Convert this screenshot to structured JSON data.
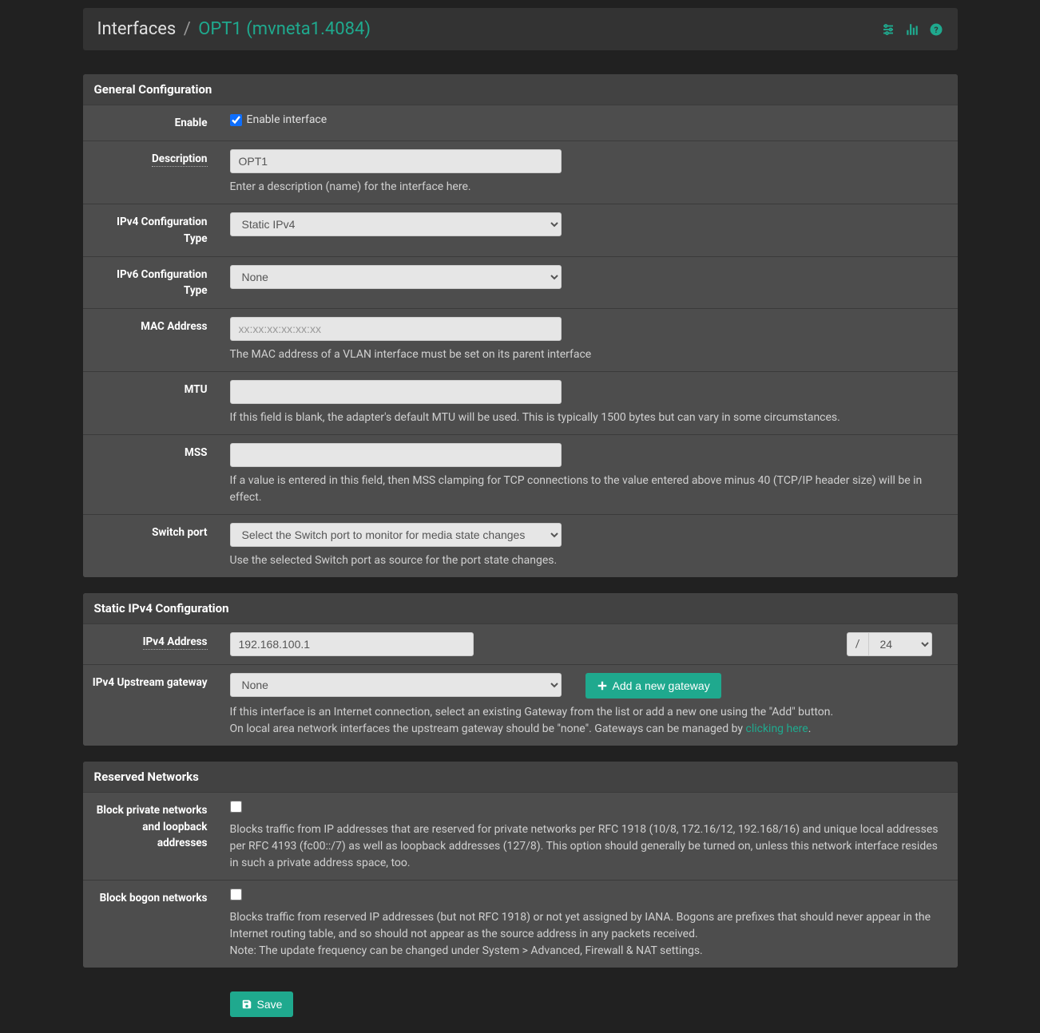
{
  "breadcrumb": {
    "root": "Interfaces",
    "sep": "/",
    "current": "OPT1 (mvneta1.4084)"
  },
  "sections": {
    "general": {
      "title": "General Configuration",
      "enable": {
        "label": "Enable",
        "text": "Enable interface",
        "checked": true
      },
      "description": {
        "label": "Description",
        "value": "OPT1",
        "help": "Enter a description (name) for the interface here."
      },
      "ipv4type": {
        "label": "IPv4 Configuration Type",
        "selected": "Static IPv4"
      },
      "ipv6type": {
        "label": "IPv6 Configuration Type",
        "selected": "None"
      },
      "mac": {
        "label": "MAC Address",
        "placeholder": "xx:xx:xx:xx:xx:xx",
        "help": "The MAC address of a VLAN interface must be set on its parent interface"
      },
      "mtu": {
        "label": "MTU",
        "help": "If this field is blank, the adapter's default MTU will be used. This is typically 1500 bytes but can vary in some circumstances."
      },
      "mss": {
        "label": "MSS",
        "help": "If a value is entered in this field, then MSS clamping for TCP connections to the value entered above minus 40 (TCP/IP header size) will be in effect."
      },
      "switchport": {
        "label": "Switch port",
        "selected": "Select the Switch port to monitor for media state changes",
        "help": "Use the selected Switch port as source for the port state changes."
      }
    },
    "staticipv4": {
      "title": "Static IPv4 Configuration",
      "address": {
        "label": "IPv4 Address",
        "value": "192.168.100.1",
        "slash": "/",
        "prefix": "24"
      },
      "gateway": {
        "label": "IPv4 Upstream gateway",
        "selected": "None",
        "button": "Add a new gateway",
        "help1": "If this interface is an Internet connection, select an existing Gateway from the list or add a new one using the \"Add\" button.",
        "help2a": "On local area network interfaces the upstream gateway should be \"none\". Gateways can be managed by ",
        "help2link": "clicking here",
        "help2b": "."
      }
    },
    "reserved": {
      "title": "Reserved Networks",
      "blockpriv": {
        "label": "Block private networks and loopback addresses",
        "help": "Blocks traffic from IP addresses that are reserved for private networks per RFC 1918 (10/8, 172.16/12, 192.168/16) and unique local addresses per RFC 4193 (fc00::/7) as well as loopback addresses (127/8). This option should generally be turned on, unless this network interface resides in such a private address space, too."
      },
      "blockbogon": {
        "label": "Block bogon networks",
        "help1": "Blocks traffic from reserved IP addresses (but not RFC 1918) or not yet assigned by IANA. Bogons are prefixes that should never appear in the Internet routing table, and so should not appear as the source address in any packets received.",
        "help2": "Note: The update frequency can be changed under System > Advanced, Firewall & NAT settings."
      }
    }
  },
  "save": {
    "label": "Save"
  }
}
